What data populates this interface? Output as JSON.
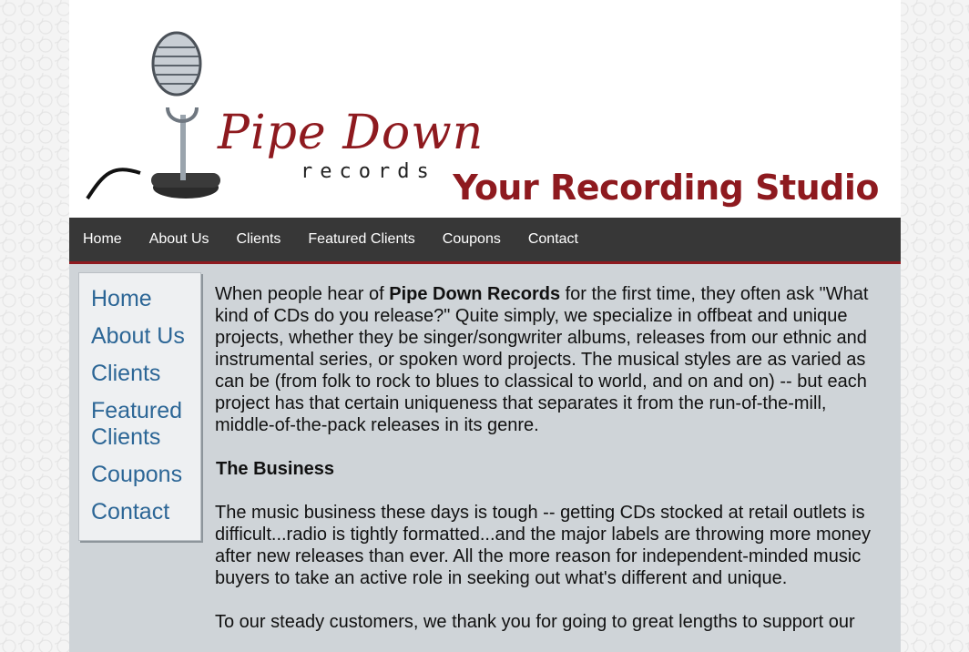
{
  "header": {
    "logo_title": "Pipe Down",
    "logo_subtitle": "records",
    "tagline": "Your Recording Studio"
  },
  "topnav": {
    "items": [
      {
        "label": "Home"
      },
      {
        "label": "About Us"
      },
      {
        "label": "Clients"
      },
      {
        "label": "Featured Clients"
      },
      {
        "label": "Coupons"
      },
      {
        "label": "Contact"
      }
    ]
  },
  "sidebar": {
    "items": [
      {
        "label": "Home"
      },
      {
        "label": "About Us"
      },
      {
        "label": "Clients"
      },
      {
        "label": "Featured Clients"
      },
      {
        "label": "Coupons"
      },
      {
        "label": "Contact"
      }
    ]
  },
  "main": {
    "intro_before": "When people hear of ",
    "intro_bold": "Pipe Down Records",
    "intro_after": " for the first time, they often ask \"What kind of CDs do you release?\" Quite simply, we specialize in offbeat and unique projects, whether they be singer/songwriter albums, releases from our ethnic and instrumental series, or spoken word projects. The musical styles are as varied as can be (from folk to rock to blues to classical to world, and on and on) -- but each project has that certain uniqueness that separates it from the run-of-the-mill, middle-of-the-pack releases in its genre.",
    "business_heading": "The Business",
    "business_text": "The music business these days is tough -- getting CDs stocked at retail outlets is difficult...radio is tightly formatted...and the major labels are throwing more money after new releases than ever. All the more reason for independent-minded music buyers to take an active role in seeking out what's different and unique.",
    "customers_text": "To our steady customers, we thank you for going to great lengths to support our"
  }
}
